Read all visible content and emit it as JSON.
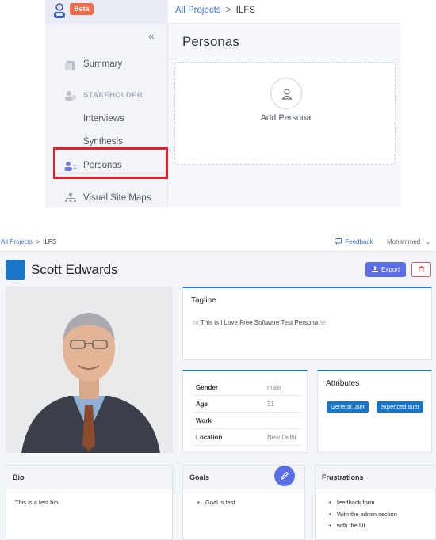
{
  "top_screen": {
    "beta_badge": "Beta",
    "breadcrumb": {
      "root": "All Projects",
      "separator": ">",
      "current": "ILFS"
    },
    "page_title": "Personas",
    "add_persona_label": "Add Persona",
    "sidebar": {
      "collapse_glyph": "«",
      "items": [
        {
          "label": "Summary",
          "icon": "summary-icon"
        },
        {
          "label": "STAKEHOLDER",
          "icon": "stakeholder-icon"
        },
        {
          "label": "Interviews"
        },
        {
          "label": "Synthesis"
        },
        {
          "label": "Personas",
          "icon": "personas-icon"
        },
        {
          "label": "Visual Site Maps",
          "icon": "sitemap-icon"
        }
      ]
    },
    "highlight_color": "#e0202a"
  },
  "persona_screen": {
    "breadcrumb": {
      "root": "All Projects",
      "separator": ">",
      "current": "ILFS"
    },
    "feedback_label": "Feedback",
    "user_name": "Mohammed",
    "persona_name": "Scott Edwards",
    "export_label": "Export",
    "tagline": {
      "title": "Tagline",
      "open_quote": "66",
      "text": "This is I Love Free Software Test Persona",
      "close_quote": "99"
    },
    "details": [
      {
        "label": "Gender",
        "value": "male"
      },
      {
        "label": "Age",
        "value": "31"
      },
      {
        "label": "Work",
        "value": ""
      },
      {
        "label": "Location",
        "value": "New Delhi"
      }
    ],
    "attributes": {
      "title": "Attributes",
      "chips": [
        "General user",
        "expericed suer"
      ]
    },
    "bio": {
      "title": "Bio",
      "text": "This is a test bio"
    },
    "goals": {
      "title": "Goals",
      "items": [
        "Goal is test"
      ]
    },
    "frustrations": {
      "title": "Frustrations",
      "items": [
        "feedback form",
        "With the admin section",
        "with the UI"
      ]
    },
    "accent_color": "#5b6ee8",
    "brand_color": "#1a75c8"
  }
}
